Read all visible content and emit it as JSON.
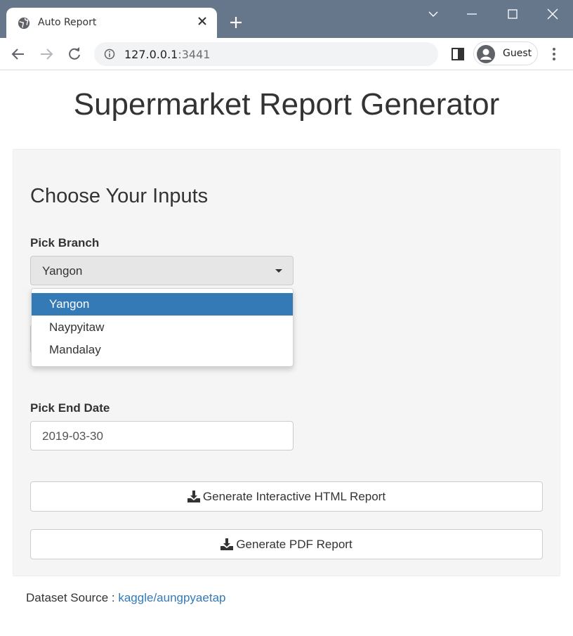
{
  "browser": {
    "tab_title": "Auto Report",
    "url_host": "127.0.0.1",
    "url_port": ":3441",
    "profile_label": "Guest",
    "colors": {
      "tabbar_bg": "#66778c",
      "omnibox_bg": "#f1f3f4"
    }
  },
  "page": {
    "title": "Supermarket Report Generator"
  },
  "inputs_panel": {
    "heading": "Choose Your Inputs",
    "branch": {
      "label": "Pick Branch",
      "selected": "Yangon",
      "options": [
        "Yangon",
        "Naypyitaw",
        "Mandalay"
      ],
      "active_option": "Yangon"
    },
    "end_date": {
      "label": "Pick End Date",
      "value": "2019-03-30"
    },
    "buttons": {
      "html_report": "Generate Interactive HTML Report",
      "pdf_report": "Generate PDF Report"
    }
  },
  "footer": {
    "prefix": "Dataset Source : ",
    "link_text": "kaggle/aungpyaetap",
    "link_color": "#337ab7"
  },
  "icons": [
    "globe-icon",
    "close-icon",
    "plus-icon",
    "chevron-down-icon",
    "minimize-icon",
    "maximize-icon",
    "window-close-icon",
    "back-arrow-icon",
    "forward-arrow-icon",
    "reload-icon",
    "info-icon",
    "side-panel-icon",
    "avatar-icon",
    "kebab-menu-icon",
    "download-icon",
    "caret-down-icon"
  ]
}
